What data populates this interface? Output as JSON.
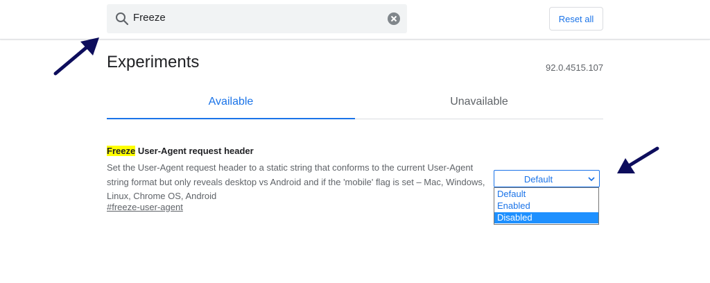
{
  "header": {
    "search": {
      "value": "Freeze",
      "placeholder": "Search flags"
    },
    "reset_label": "Reset all"
  },
  "main": {
    "title": "Experiments",
    "version": "92.0.4515.107",
    "tabs": [
      {
        "label": "Available",
        "active": true
      },
      {
        "label": "Unavailable",
        "active": false
      }
    ]
  },
  "flag": {
    "name_highlight": "Freeze",
    "name_rest": " User-Agent request header",
    "description": "Set the User-Agent request header to a static string that conforms to the current User-Agent string format but only reveals desktop vs Android and if the 'mobile' flag is set – Mac, Windows, Linux, Chrome OS, Android",
    "link": "#freeze-user-agent",
    "select": {
      "value": "Default",
      "options": [
        "Default",
        "Enabled",
        "Disabled"
      ],
      "highlighted_option": "Disabled"
    }
  },
  "colors": {
    "accent": "#1a73e8",
    "highlight": "#ffff00",
    "annotation_arrow": "#0d0d5c",
    "option_highlight": "#1e90ff"
  },
  "icons": {
    "search": "search-icon",
    "clear": "clear-icon",
    "chevron": "chevron-down-icon",
    "arrow": "arrow-icon"
  }
}
